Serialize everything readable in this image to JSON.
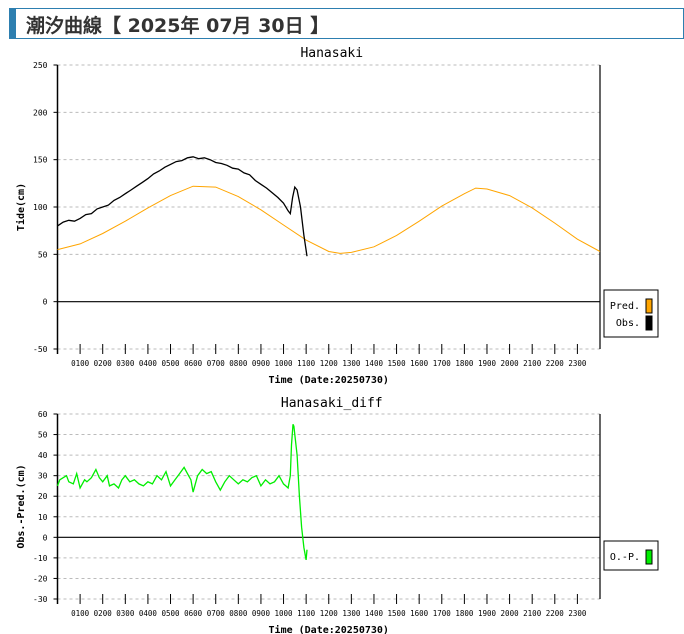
{
  "header": {
    "title": "潮汐曲線【 2025年 07月 30日 】"
  },
  "colors": {
    "pred": "#ffa500",
    "obs": "#000000",
    "diff": "#00ee00",
    "header": "#2d7fb0"
  },
  "chart_data": [
    {
      "type": "line",
      "title": "Hanasaki",
      "xlabel": "Time (Date:20250730)",
      "ylabel": "Tide(cm)",
      "xlim": [
        0,
        24
      ],
      "ylim": [
        -50,
        250
      ],
      "yticks": [
        "250",
        "200",
        "150",
        "100",
        "50",
        "0",
        "-50"
      ],
      "ytick_values": [
        250,
        200,
        150,
        100,
        50,
        0,
        -50
      ],
      "xticks": [
        "0100",
        "0200",
        "0300",
        "0400",
        "0500",
        "0600",
        "0700",
        "0800",
        "0900",
        "1000",
        "1100",
        "1200",
        "1300",
        "1400",
        "1500",
        "1600",
        "1700",
        "1800",
        "1900",
        "2000",
        "2100",
        "2200",
        "2300"
      ],
      "grid": true,
      "legend": {
        "placement": "right",
        "entries": [
          "Pred.",
          "Obs."
        ]
      },
      "series": [
        {
          "name": "Pred.",
          "x": [
            0,
            1,
            2,
            3,
            4,
            5,
            6,
            7,
            8,
            9,
            10,
            11,
            12,
            12.5,
            13,
            14,
            15,
            16,
            17,
            18,
            18.5,
            19,
            20,
            21,
            22,
            23,
            24
          ],
          "y": [
            55,
            61,
            72,
            85,
            99,
            112,
            122,
            121,
            111,
            97,
            81,
            65,
            53,
            51,
            52,
            58,
            70,
            85,
            101,
            114,
            120,
            119,
            112,
            99,
            83,
            66,
            53
          ]
        },
        {
          "name": "Obs.",
          "x": [
            0,
            0.25,
            0.5,
            0.75,
            1,
            1.25,
            1.5,
            1.75,
            2,
            2.25,
            2.5,
            2.75,
            3,
            3.25,
            3.5,
            3.75,
            4,
            4.25,
            4.5,
            4.75,
            5,
            5.25,
            5.5,
            5.75,
            6,
            6.25,
            6.5,
            6.75,
            7,
            7.25,
            7.5,
            7.75,
            8,
            8.25,
            8.5,
            8.75,
            9,
            9.25,
            9.5,
            9.75,
            10,
            10.2,
            10.3,
            10.4,
            10.5,
            10.6,
            10.75,
            10.9,
            11.04
          ],
          "y": [
            80,
            84,
            86,
            85,
            88,
            92,
            93,
            98,
            100,
            102,
            107,
            110,
            114,
            118,
            122,
            126,
            130,
            135,
            138,
            142,
            145,
            148,
            149,
            152,
            153,
            151,
            152,
            150,
            147,
            146,
            144,
            141,
            140,
            136,
            134,
            128,
            124,
            120,
            115,
            110,
            104,
            96,
            93,
            110,
            121,
            118,
            100,
            70,
            48
          ]
        }
      ]
    },
    {
      "type": "line",
      "title": "Hanasaki_diff",
      "xlabel": "Time (Date:20250730)",
      "ylabel": "Obs.-Pred.(cm)",
      "xlim": [
        0,
        24
      ],
      "ylim": [
        -30,
        60
      ],
      "yticks": [
        "60",
        "50",
        "40",
        "30",
        "20",
        "10",
        "0",
        "-10",
        "-20",
        "-30"
      ],
      "ytick_values": [
        60,
        50,
        40,
        30,
        20,
        10,
        0,
        -10,
        -20,
        -30
      ],
      "xticks": [
        "0100",
        "0200",
        "0300",
        "0400",
        "0500",
        "0600",
        "0700",
        "0800",
        "0900",
        "1000",
        "1100",
        "1200",
        "1300",
        "1400",
        "1500",
        "1600",
        "1700",
        "1800",
        "1900",
        "2000",
        "2100",
        "2200",
        "2300"
      ],
      "grid": true,
      "legend": {
        "placement": "right",
        "entries": [
          "O.-P."
        ]
      },
      "series": [
        {
          "name": "O.-P.",
          "x": [
            0,
            0.1,
            0.25,
            0.4,
            0.5,
            0.7,
            0.85,
            1,
            1.2,
            1.3,
            1.5,
            1.7,
            1.85,
            2,
            2.2,
            2.3,
            2.5,
            2.7,
            2.85,
            3,
            3.2,
            3.4,
            3.6,
            3.8,
            4,
            4.2,
            4.4,
            4.6,
            4.8,
            5,
            5.2,
            5.4,
            5.6,
            5.8,
            5.9,
            6,
            6.2,
            6.4,
            6.6,
            6.8,
            7,
            7.1,
            7.2,
            7.4,
            7.6,
            7.8,
            8,
            8.2,
            8.4,
            8.6,
            8.8,
            9,
            9.2,
            9.4,
            9.6,
            9.8,
            10,
            10.1,
            10.2,
            10.3,
            10.35,
            10.42,
            10.46,
            10.5,
            10.6,
            10.7,
            10.8,
            10.9,
            10.95,
            11.0,
            11.04
          ],
          "y": [
            25,
            28,
            29,
            30,
            27,
            26,
            31,
            24,
            28,
            27,
            29,
            33,
            29,
            27,
            30,
            25,
            26,
            24,
            28,
            30,
            27,
            28,
            26,
            25,
            27,
            26,
            30,
            28,
            32,
            25,
            28,
            31,
            34,
            30,
            28,
            22,
            30,
            33,
            31,
            32,
            27,
            25,
            23,
            27,
            30,
            28,
            26,
            28,
            27,
            29,
            30,
            25,
            28,
            26,
            27,
            30,
            26,
            25,
            24,
            30,
            45,
            55,
            54,
            50,
            40,
            20,
            5,
            -5,
            -8,
            -11,
            -6
          ]
        }
      ]
    }
  ]
}
